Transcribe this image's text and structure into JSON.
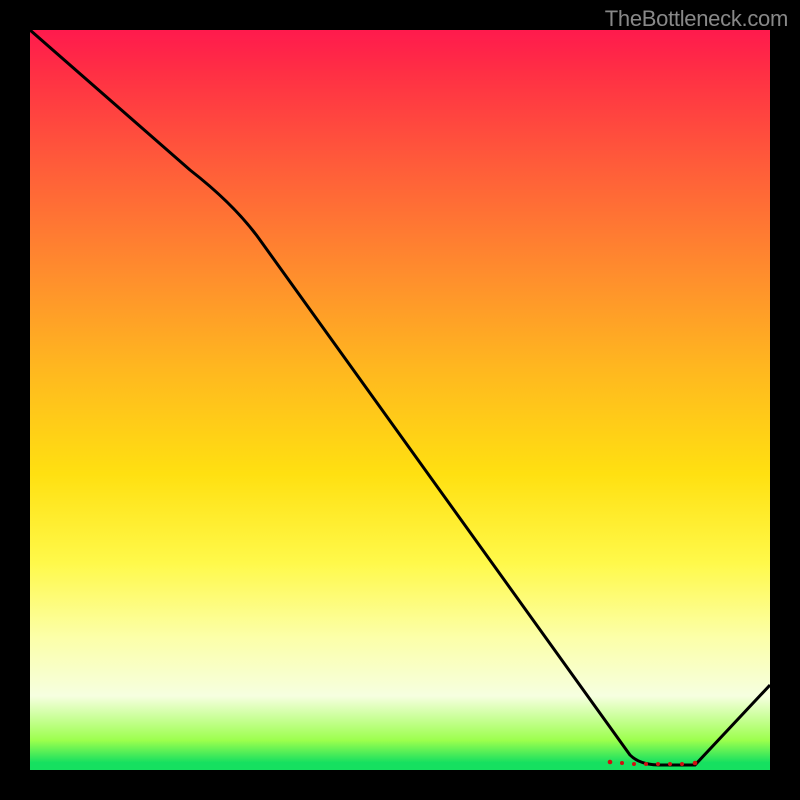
{
  "attribution": "TheBottleneck.com",
  "marker_label": "",
  "chart_data": {
    "type": "line",
    "title": "",
    "xlabel": "",
    "ylabel": "",
    "xlim": [
      0,
      100
    ],
    "ylim": [
      0,
      100
    ],
    "series": [
      {
        "name": "curve",
        "x": [
          0,
          28,
          80,
          88,
          100
        ],
        "y": [
          100,
          78,
          0,
          0,
          12
        ]
      }
    ],
    "markers": {
      "name": "highlight-band",
      "x_start": 78,
      "x_end": 90,
      "y": 0
    },
    "gradient_stops": [
      {
        "pos": 0.0,
        "color": "#ff1a4d"
      },
      {
        "pos": 0.5,
        "color": "#ffd400"
      },
      {
        "pos": 0.85,
        "color": "#fcffc0"
      },
      {
        "pos": 1.0,
        "color": "#16e060"
      }
    ]
  }
}
